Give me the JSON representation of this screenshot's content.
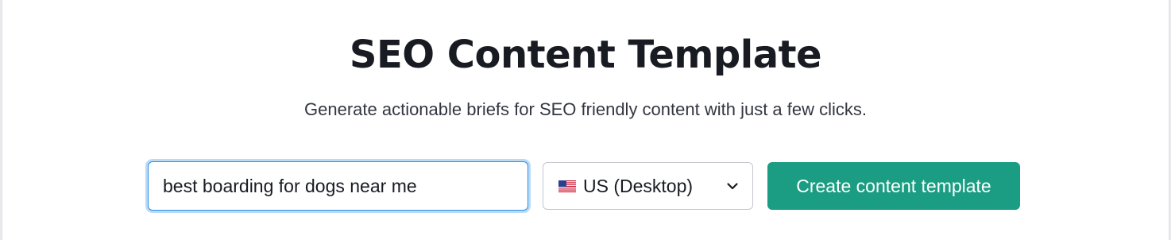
{
  "header": {
    "title": "SEO Content Template",
    "subtitle": "Generate actionable briefs for SEO friendly content with just a few clicks."
  },
  "form": {
    "keyword_value": "best boarding for dogs near me",
    "database": {
      "flag_icon": "us-flag-icon",
      "selected_label": "US (Desktop)",
      "dropdown_icon": "chevron-down-icon"
    },
    "submit_label": "Create content template"
  },
  "colors": {
    "primary_button": "#1a9d82",
    "input_focus_border": "#2c8fe8",
    "input_focus_ring": "#b9dbf8",
    "title_text": "#191b23"
  }
}
